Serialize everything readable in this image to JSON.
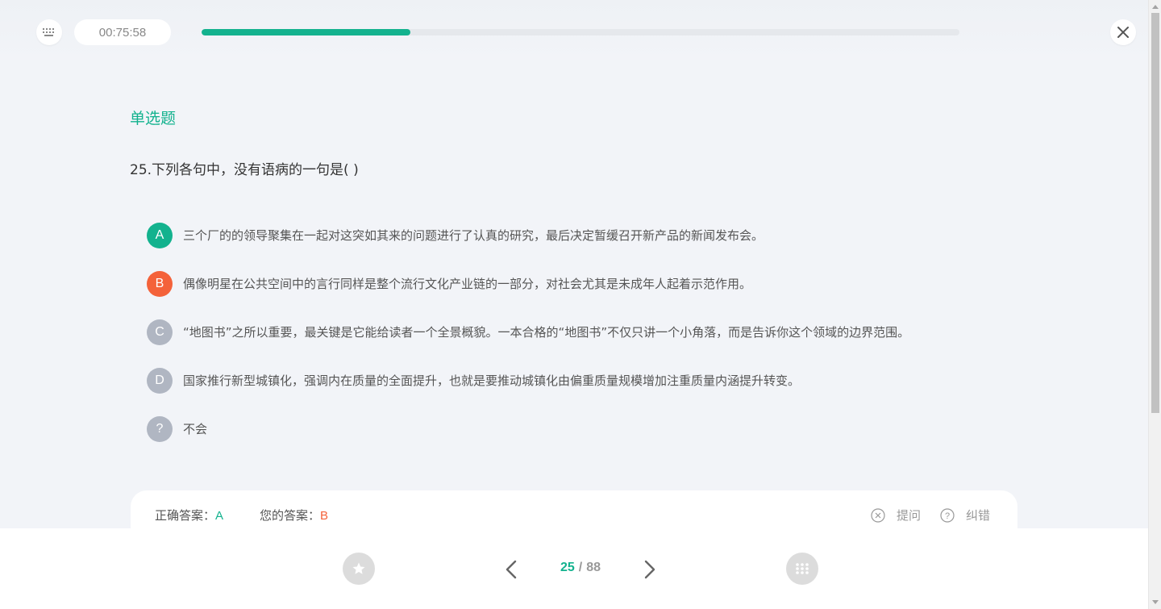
{
  "header": {
    "timer": "00:75:58",
    "progress": 0.275
  },
  "question": {
    "type_label": "单选题",
    "text": "25.下列各句中，没有语病的一句是( )",
    "options": [
      {
        "letter": "A",
        "text": "三个厂的的领导聚集在一起对这突如其来的问题进行了认真的研究，最后决定暂缓召开新产品的新闻发布会。",
        "state": "correct",
        "color": "#13b28e"
      },
      {
        "letter": "B",
        "text": "偶像明星在公共空间中的言行同样是整个流行文化产业链的一部分，对社会尤其是未成年人起着示范作用。",
        "state": "selected-wrong",
        "color": "#f4623a"
      },
      {
        "letter": "C",
        "text": "“地图书”之所以重要，最关键是它能给读者一个全景概貌。一本合格的“地图书”不仅只讲一个小角落，而是告诉你这个领域的边界范围。",
        "state": "neutral",
        "color": "#b0b6c2"
      },
      {
        "letter": "D",
        "text": "国家推行新型城镇化，强调内在质量的全面提升，也就是要推动城镇化由偏重质量规模增加注重质量内涵提升转变。",
        "state": "neutral",
        "color": "#b0b6c2"
      },
      {
        "letter": "?",
        "text": "不会",
        "state": "neutral",
        "color": "#b0b6c2"
      }
    ]
  },
  "answer": {
    "correct_label": "正确答案：",
    "correct_value": "A",
    "mine_label": "您的答案：",
    "mine_value": "B",
    "ask_label": "提问",
    "report_label": "纠错"
  },
  "footer": {
    "current": "25",
    "separator": "/",
    "total": "88"
  },
  "colors": {
    "accent": "#13b28e",
    "wrong": "#f4623a",
    "neutral": "#b0b6c2"
  }
}
